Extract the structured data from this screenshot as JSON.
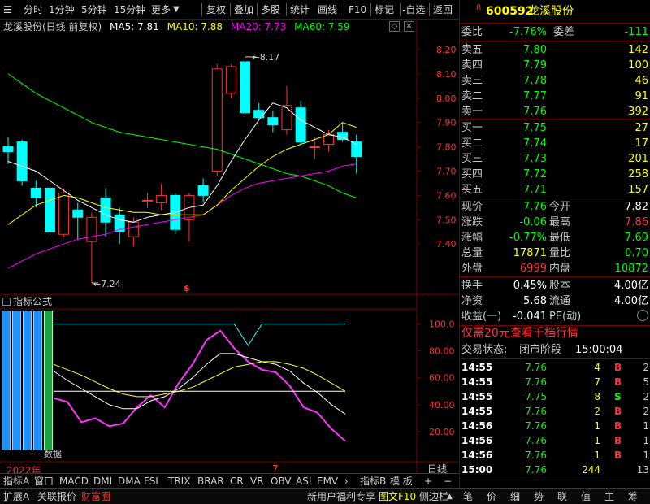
{
  "toolbar": {
    "left_tabs": [
      "分时",
      "1分钟",
      "5分钟",
      "15分钟",
      "更多"
    ],
    "right_tools": [
      "复权",
      "叠加",
      "多股",
      "统计",
      "画线",
      "F10",
      "标记",
      "-自选",
      "返回"
    ]
  },
  "chart_header": {
    "stock_title": "龙溪股份(日线 前复权)",
    "ma5": "MA5: 7.81",
    "ma10": "MA10: 7.88",
    "ma20": "MA20: 7.73",
    "ma60": "MA60: 7.59",
    "ma5_color": "#ffffff",
    "ma10_color": "#ffff00",
    "ma20_color": "#ff00ff",
    "ma60_color": "#00ff00"
  },
  "indicator_header": {
    "title": "指标公式"
  },
  "colors": {
    "up": "#ff3232",
    "down": "#00ffff",
    "grid": "#7a0000"
  },
  "chart_data": [
    {
      "type": "candlestick",
      "title": "龙溪股份(日线 前复权)",
      "y_ticks": [
        "8.20",
        "8.10",
        "8.00",
        "7.90",
        "7.80",
        "7.70",
        "7.60",
        "7.50",
        "7.40"
      ],
      "ylim": [
        7.2,
        8.25
      ],
      "annotations": {
        "high": "8.17",
        "low": "7.24",
        "marker": "$"
      },
      "candles": [
        {
          "o": 7.8,
          "c": 7.78,
          "h": 7.84,
          "l": 7.73
        },
        {
          "o": 7.82,
          "c": 7.66,
          "h": 7.83,
          "l": 7.64
        },
        {
          "o": 7.63,
          "c": 7.59,
          "h": 7.66,
          "l": 7.55
        },
        {
          "o": 7.63,
          "c": 7.45,
          "h": 7.64,
          "l": 7.42
        },
        {
          "o": 7.44,
          "c": 7.61,
          "h": 7.63,
          "l": 7.43
        },
        {
          "o": 7.54,
          "c": 7.51,
          "h": 7.57,
          "l": 7.42
        },
        {
          "o": 7.41,
          "c": 7.51,
          "h": 7.53,
          "l": 7.24
        },
        {
          "o": 7.59,
          "c": 7.49,
          "h": 7.63,
          "l": 7.43
        },
        {
          "o": 7.52,
          "c": 7.45,
          "h": 7.55,
          "l": 7.4
        },
        {
          "o": 7.43,
          "c": 7.49,
          "h": 7.51,
          "l": 7.39
        },
        {
          "o": 7.58,
          "c": 7.58,
          "h": 7.61,
          "l": 7.55
        },
        {
          "o": 7.57,
          "c": 7.6,
          "h": 7.65,
          "l": 7.54
        },
        {
          "o": 7.6,
          "c": 7.46,
          "h": 7.61,
          "l": 7.44
        },
        {
          "o": 7.5,
          "c": 7.6,
          "h": 7.61,
          "l": 7.41
        },
        {
          "o": 7.64,
          "c": 7.6,
          "h": 7.67,
          "l": 7.57
        },
        {
          "o": 7.7,
          "c": 8.12,
          "h": 8.14,
          "l": 7.68
        },
        {
          "o": 8.02,
          "c": 8.13,
          "h": 8.14,
          "l": 8.0
        },
        {
          "o": 8.15,
          "c": 7.94,
          "h": 8.17,
          "l": 7.93
        },
        {
          "o": 7.95,
          "c": 7.92,
          "h": 7.98,
          "l": 7.91
        },
        {
          "o": 7.92,
          "c": 7.89,
          "h": 7.95,
          "l": 7.86
        },
        {
          "o": 7.87,
          "c": 7.97,
          "h": 8.05,
          "l": 7.85
        },
        {
          "o": 7.96,
          "c": 7.82,
          "h": 7.99,
          "l": 7.81
        },
        {
          "o": 7.8,
          "c": 7.8,
          "h": 7.84,
          "l": 7.75
        },
        {
          "o": 7.81,
          "c": 7.85,
          "h": 7.87,
          "l": 7.78
        },
        {
          "o": 7.86,
          "c": 7.83,
          "h": 7.9,
          "l": 7.82
        },
        {
          "o": 7.82,
          "c": 7.76,
          "h": 7.85,
          "l": 7.69
        }
      ],
      "ma5": [
        7.74,
        7.72,
        7.7,
        7.66,
        7.62,
        7.58,
        7.55,
        7.52,
        7.5,
        7.49,
        7.51,
        7.52,
        7.53,
        7.55,
        7.56,
        7.64,
        7.74,
        7.83,
        7.91,
        7.98,
        7.96,
        7.91,
        7.88,
        7.85,
        7.84,
        7.81
      ],
      "ma10": [
        7.48,
        7.52,
        7.56,
        7.58,
        7.6,
        7.59,
        7.57,
        7.55,
        7.54,
        7.53,
        7.53,
        7.52,
        7.52,
        7.52,
        7.52,
        7.56,
        7.62,
        7.67,
        7.72,
        7.76,
        7.79,
        7.81,
        7.83,
        7.85,
        7.9,
        7.88
      ],
      "ma20": [
        7.3,
        7.33,
        7.36,
        7.38,
        7.4,
        7.42,
        7.43,
        7.44,
        7.46,
        7.47,
        7.48,
        7.49,
        7.5,
        7.51,
        7.52,
        7.56,
        7.6,
        7.63,
        7.65,
        7.66,
        7.67,
        7.68,
        7.69,
        7.7,
        7.72,
        7.73
      ],
      "ma60": [
        8.1,
        8.06,
        8.02,
        7.99,
        7.96,
        7.93,
        7.9,
        7.88,
        7.86,
        7.85,
        7.84,
        7.83,
        7.82,
        7.81,
        7.8,
        7.79,
        7.77,
        7.75,
        7.73,
        7.71,
        7.69,
        7.68,
        7.66,
        7.64,
        7.61,
        7.59
      ]
    },
    {
      "type": "line",
      "title": "指标公式",
      "y_ticks": [
        "100.0",
        "80.00",
        "60.00",
        "40.00",
        "20.00"
      ],
      "ylim": [
        0,
        110
      ],
      "series": [
        {
          "color": "#ff32ff",
          "values": [
            45,
            42,
            27,
            30,
            24,
            26,
            38,
            47,
            38,
            56,
            70,
            88,
            95,
            82,
            72,
            66,
            64,
            54,
            38,
            34,
            22,
            13
          ]
        },
        {
          "color": "#ffffff",
          "values": [
            65,
            58,
            52,
            46,
            40,
            37,
            37,
            43,
            46,
            52,
            60,
            70,
            78,
            78,
            75,
            72,
            70,
            65,
            56,
            49,
            40,
            33
          ]
        },
        {
          "color": "#ffff32",
          "values": [
            70,
            66,
            62,
            57,
            52,
            48,
            46,
            46,
            48,
            50,
            53,
            58,
            63,
            68,
            70,
            72,
            72,
            70,
            67,
            62,
            56,
            50
          ]
        },
        {
          "color": "#32ffff",
          "values": [
            100,
            100,
            100,
            100,
            100,
            100,
            100,
            100,
            100,
            100,
            100,
            100,
            100,
            100,
            84,
            100,
            100,
            100,
            100,
            100,
            100,
            100
          ]
        },
        {
          "color": "#ffffff",
          "values": [
            50,
            50,
            50,
            50,
            50,
            50,
            50,
            50,
            50,
            50,
            50,
            50,
            50,
            50,
            50,
            50,
            50,
            50,
            50,
            50,
            50,
            50
          ]
        }
      ]
    }
  ],
  "date_axis": {
    "year": "2022年",
    "month": "7",
    "right_label": "日线"
  },
  "side_label": "数据",
  "quote": {
    "code": "600592",
    "name": "龙溪股份",
    "r_mark": "R",
    "weibi_label": "委比",
    "weibi_value": "-7.76%",
    "weicha_label": "委差",
    "weicha_value": "-111",
    "asks": [
      {
        "label": "卖五",
        "price": "7.80",
        "vol": "142"
      },
      {
        "label": "卖四",
        "price": "7.79",
        "vol": "100"
      },
      {
        "label": "卖三",
        "price": "7.78",
        "vol": "46"
      },
      {
        "label": "卖二",
        "price": "7.77",
        "vol": "91"
      },
      {
        "label": "卖一",
        "price": "7.76",
        "vol": "392"
      }
    ],
    "bids": [
      {
        "label": "买一",
        "price": "7.75",
        "vol": "27"
      },
      {
        "label": "买二",
        "price": "7.74",
        "vol": "17"
      },
      {
        "label": "买三",
        "price": "7.73",
        "vol": "201"
      },
      {
        "label": "买四",
        "price": "7.72",
        "vol": "258"
      },
      {
        "label": "买五",
        "price": "7.71",
        "vol": "157"
      }
    ],
    "stats": [
      {
        "l1": "现价",
        "v1": "7.76",
        "c1": "#00ff00",
        "l2": "今开",
        "v2": "7.82",
        "c2": "#ffffff"
      },
      {
        "l1": "涨跌",
        "v1": "-0.06",
        "c1": "#00ff00",
        "l2": "最高",
        "v2": "7.86",
        "c2": "#ff3232"
      },
      {
        "l1": "涨幅",
        "v1": "-0.77%",
        "c1": "#00ff00",
        "l2": "最低",
        "v2": "7.69",
        "c2": "#00ff00"
      },
      {
        "l1": "总量",
        "v1": "17871",
        "c1": "#ffff00",
        "l2": "量比",
        "v2": "0.70",
        "c2": "#00ff00"
      },
      {
        "l1": "外盘",
        "v1": "6999",
        "c1": "#ff3232",
        "l2": "内盘",
        "v2": "10872",
        "c2": "#00ff00"
      }
    ],
    "stats2": [
      {
        "l1": "换手",
        "v1": "0.45%",
        "l2": "股本",
        "v2": "4.00亿"
      },
      {
        "l1": "净资",
        "v1": "5.68",
        "l2": "流通",
        "v2": "4.00亿"
      },
      {
        "l1": "收益(一)",
        "v1": "-0.041",
        "l2": "PE(动)",
        "v2": ""
      }
    ],
    "promo": "仅需20元查看千档行情",
    "trade_status_label": "交易状态:",
    "trade_status_value": "闭市阶段",
    "trade_status_time": "15:00:04",
    "ticks": [
      {
        "time": "14:55",
        "price": "7.76",
        "vol": "4",
        "bs": "B",
        "n": "2"
      },
      {
        "time": "14:55",
        "price": "7.76",
        "vol": "7",
        "bs": "B",
        "n": "5"
      },
      {
        "time": "14:55",
        "price": "7.75",
        "vol": "8",
        "bs": "S",
        "n": "2"
      },
      {
        "time": "14:55",
        "price": "7.76",
        "vol": "2",
        "bs": "B",
        "n": "2"
      },
      {
        "time": "14:56",
        "price": "7.76",
        "vol": "1",
        "bs": "B",
        "n": "1"
      },
      {
        "time": "14:56",
        "price": "7.76",
        "vol": "1",
        "bs": "B",
        "n": "1"
      },
      {
        "time": "14:56",
        "price": "7.76",
        "vol": "1",
        "bs": "B",
        "n": "1"
      },
      {
        "time": "15:00",
        "price": "7.76",
        "vol": "244",
        "bs": "",
        "n": "13"
      }
    ]
  },
  "indicator_tabs": [
    "指标A",
    "窗口",
    "MACD",
    "DMI",
    "DMA",
    "FSL",
    "TRIX",
    "BRAR",
    "CR",
    "VR",
    "OBV",
    "ASI",
    "EMV",
    "指标B",
    "模 板"
  ],
  "status_left": [
    "扩展A",
    "关联报价",
    "财富圈"
  ],
  "status_right": [
    "新用户福利专享",
    "图文F10",
    "侧边栏"
  ],
  "status_tools": [
    "笔",
    "价",
    "细",
    "势",
    "联",
    "值",
    "主",
    "筹"
  ]
}
